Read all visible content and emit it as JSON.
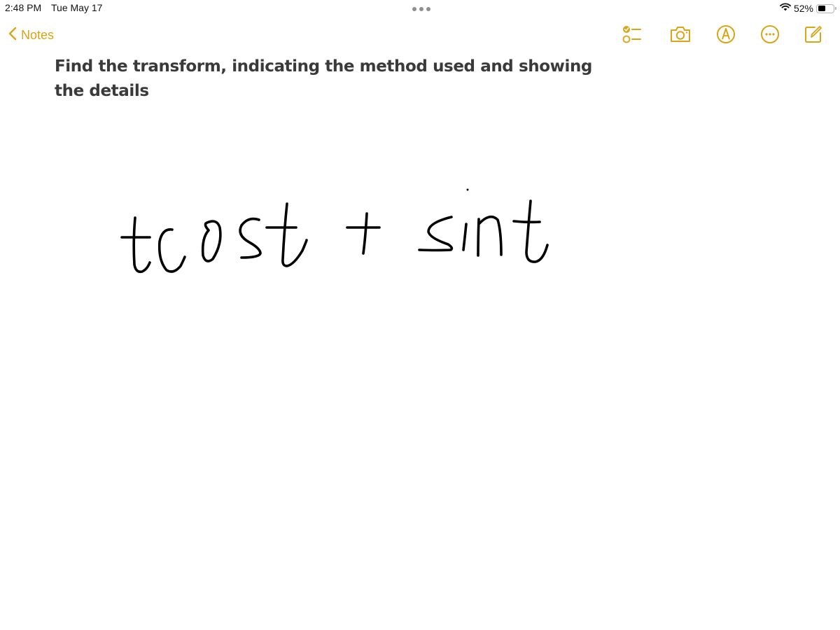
{
  "status_bar": {
    "time": "2:48 PM",
    "date": "Tue May 17",
    "battery_percent_label": "52%",
    "battery_level": 0.52,
    "wifi_icon": "wifi-icon"
  },
  "nav": {
    "back_label": "Notes",
    "back_icon": "chevron-left-icon",
    "toolbar": [
      {
        "name": "checklist",
        "icon": "checklist-icon"
      },
      {
        "name": "camera",
        "icon": "camera-icon"
      },
      {
        "name": "markup",
        "icon": "markup-pen-icon"
      },
      {
        "name": "more",
        "icon": "ellipsis-circle-icon"
      },
      {
        "name": "compose",
        "icon": "compose-icon"
      }
    ],
    "accent_color": "#d9a514"
  },
  "note": {
    "title": "Find the transform, indicating the method used and showing the details",
    "handwriting_text": "tcost + sint",
    "ink_color": "#000000"
  }
}
